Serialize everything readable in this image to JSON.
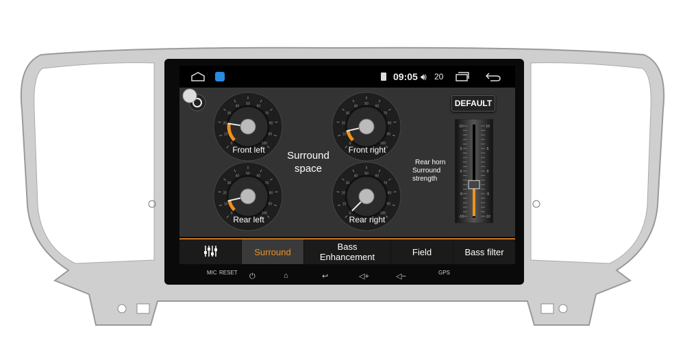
{
  "status_bar": {
    "time": "09:05",
    "volume": "20",
    "icons": [
      "home-icon",
      "app-icon",
      "sim-icon",
      "volume-icon",
      "recent-apps-icon",
      "back-icon"
    ]
  },
  "gauges": [
    {
      "label": "Front left",
      "value": 20
    },
    {
      "label": "Front right",
      "value": 12
    },
    {
      "label": "Rear left",
      "value": 12
    },
    {
      "label": "Rear right",
      "value": 0
    }
  ],
  "gauge_scale": {
    "min": 0,
    "max": 100,
    "step": 10
  },
  "center_title_line1": "Surround",
  "center_title_line2": "space",
  "default_button": "DEFAULT",
  "slider": {
    "label_line1": "Rear horn",
    "label_line2": "Surround",
    "label_line3": "strength",
    "min": -10,
    "max": 10,
    "value": -3,
    "ticks": [
      "10",
      "5",
      "0",
      "-5",
      "-10"
    ]
  },
  "tabs": [
    {
      "label": "",
      "icon": "equalizer-icon"
    },
    {
      "label": "Surround",
      "active": true
    },
    {
      "label": "Bass Enhancement"
    },
    {
      "label": "Field"
    },
    {
      "label": "Bass filter"
    }
  ],
  "hardware": {
    "mic": "MIC",
    "reset": "RESET",
    "gps": "GPS"
  },
  "colors": {
    "accent": "#f0901e",
    "screen_bg": "#333333",
    "bezel": "#c9c9c9"
  }
}
